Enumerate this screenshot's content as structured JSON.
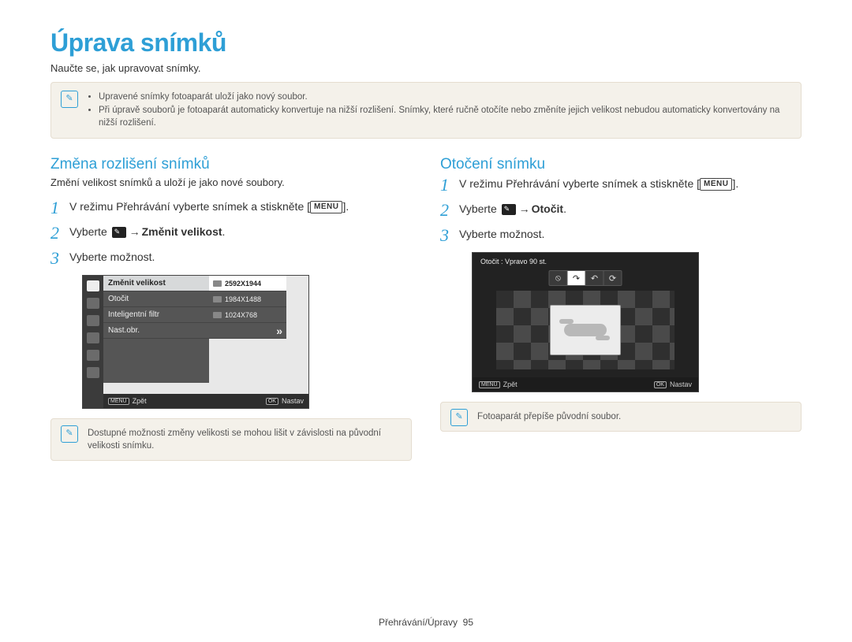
{
  "title": "Úprava snímků",
  "intro": "Naučte se, jak upravovat snímky.",
  "topbox": {
    "bullets": [
      "Upravené snímky fotoaparát uloží jako nový soubor.",
      "Při úpravě souborů je fotoaparát automaticky konvertuje na nižší rozlišení. Snímky, které ručně otočíte nebo změníte jejich velikost nebudou automaticky konvertovány na nižší rozlišení."
    ]
  },
  "labels": {
    "menu": "MENU",
    "ok": "OK",
    "back": "Zpět",
    "set": "Nastav"
  },
  "left": {
    "heading": "Změna rozlišení snímků",
    "sub": "Změní velikost snímků a uloží je jako nové soubory.",
    "step1_a": "V režimu Přehrávání vyberte snímek a stiskněte [",
    "step1_b": "].",
    "step2_a": "Vyberte ",
    "step2_arrow": " → ",
    "step2_b": "Změnit velikost",
    "step2_c": ".",
    "step3": "Vyberte možnost.",
    "menu_items": [
      "Změnit velikost",
      "Otočit",
      "Inteligentní filtr",
      "Nast.obr."
    ],
    "res_items": [
      "2592X1944",
      "1984X1488",
      "1024X768"
    ],
    "note": "Dostupné možnosti změny velikosti se mohou lišit v závislosti na původní velikosti snímku."
  },
  "right": {
    "heading": "Otočení snímku",
    "step1_a": "V režimu Přehrávání vyberte snímek a stiskněte [",
    "step1_b": "].",
    "step2_a": "Vyberte ",
    "step2_arrow": " → ",
    "step2_b": "Otočit",
    "step2_c": ".",
    "step3": "Vyberte možnost.",
    "lcd_title": "Otočit : Vpravo 90 st.",
    "note": "Fotoaparát přepíše původní soubor."
  },
  "footer": {
    "section": "Přehrávání/Úpravy",
    "page": "95"
  }
}
